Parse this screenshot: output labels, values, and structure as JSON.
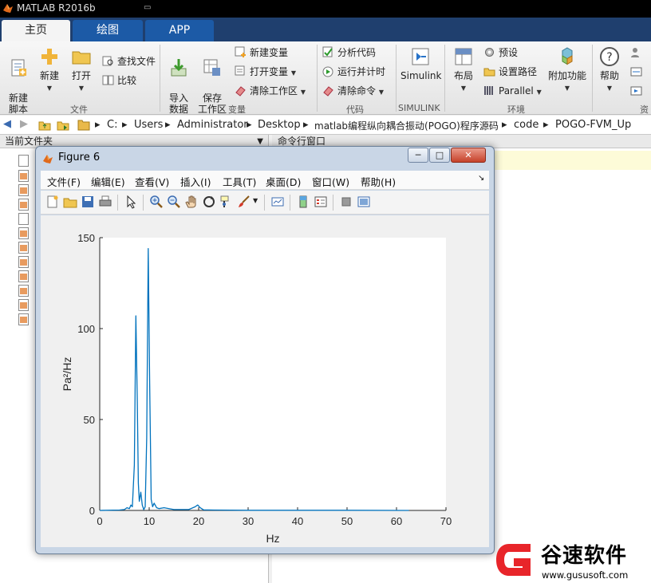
{
  "app": {
    "title": "MATLAB R2016b"
  },
  "tabs": [
    {
      "label": "主页"
    },
    {
      "label": "绘图"
    },
    {
      "label": "APP"
    }
  ],
  "ribbon": {
    "file": {
      "new_script": "新建\n脚本",
      "new": "新建",
      "open": "打开",
      "find_files": "查找文件",
      "compare": "比较",
      "section": "文件"
    },
    "variable": {
      "import": "导入\n数据",
      "save_ws": "保存\n工作区",
      "new_var": "新建变量",
      "open_var": "打开变量",
      "clear_ws": "清除工作区",
      "section": "变量"
    },
    "code": {
      "analyze": "分析代码",
      "run_time": "运行并计时",
      "clear_cmd": "清除命令",
      "section": "代码"
    },
    "simulink": {
      "label": "Simulink",
      "section": "SIMULINK"
    },
    "env": {
      "layout": "布局",
      "prefs": "预设",
      "set_path": "设置路径",
      "parallel": "Parallel",
      "addons": "附加功能",
      "section": "环境"
    },
    "resources": {
      "help": "帮助",
      "section": "资"
    }
  },
  "address": {
    "path": [
      "C:",
      "Users",
      "Administrator",
      "Desktop",
      "matlab编程纵向耦合振动(POGO)程序源码",
      "code",
      "POGO-FVM_Up"
    ]
  },
  "panels": {
    "current_folder": "当前文件夹",
    "command_window": "命令行窗口"
  },
  "figure": {
    "title": "Figure 6",
    "menus": [
      "文件(F)",
      "编辑(E)",
      "查看(V)",
      "插入(I)",
      "工具(T)",
      "桌面(D)",
      "窗口(W)",
      "帮助(H)"
    ]
  },
  "chart_data": {
    "type": "line",
    "xlabel": "Hz",
    "ylabel": "Pa²/Hz",
    "xlim": [
      0,
      70
    ],
    "ylim": [
      0,
      150
    ],
    "xticks": [
      0,
      10,
      20,
      30,
      40,
      50,
      60,
      70
    ],
    "yticks": [
      0,
      50,
      100,
      150
    ],
    "grid": false,
    "line_color": "#0072bd",
    "series": [
      {
        "x": [
          0,
          4,
          5,
          5.5,
          6,
          6.3,
          6.6,
          7,
          7.3,
          7.6,
          7.8,
          8,
          8.3,
          8.6,
          8.9,
          9.2,
          9.5,
          9.8,
          10.1,
          10.4,
          10.7,
          11,
          11.5,
          12,
          13,
          15,
          18,
          19.3,
          19.8,
          20.3,
          21,
          23,
          30,
          40,
          50,
          62.5
        ],
        "y": [
          0,
          0.2,
          0.5,
          1.5,
          1,
          3,
          2,
          25,
          107,
          60,
          15,
          5,
          10,
          3,
          0.5,
          2,
          40,
          144,
          70,
          6,
          2,
          4,
          1.5,
          1,
          1.5,
          0.5,
          0.5,
          2,
          3,
          1.5,
          0.3,
          0.2,
          0.1,
          0.1,
          0.1,
          0
        ]
      }
    ]
  },
  "watermark": {
    "brand": "谷速软件",
    "url": "www.gususoft.com"
  }
}
